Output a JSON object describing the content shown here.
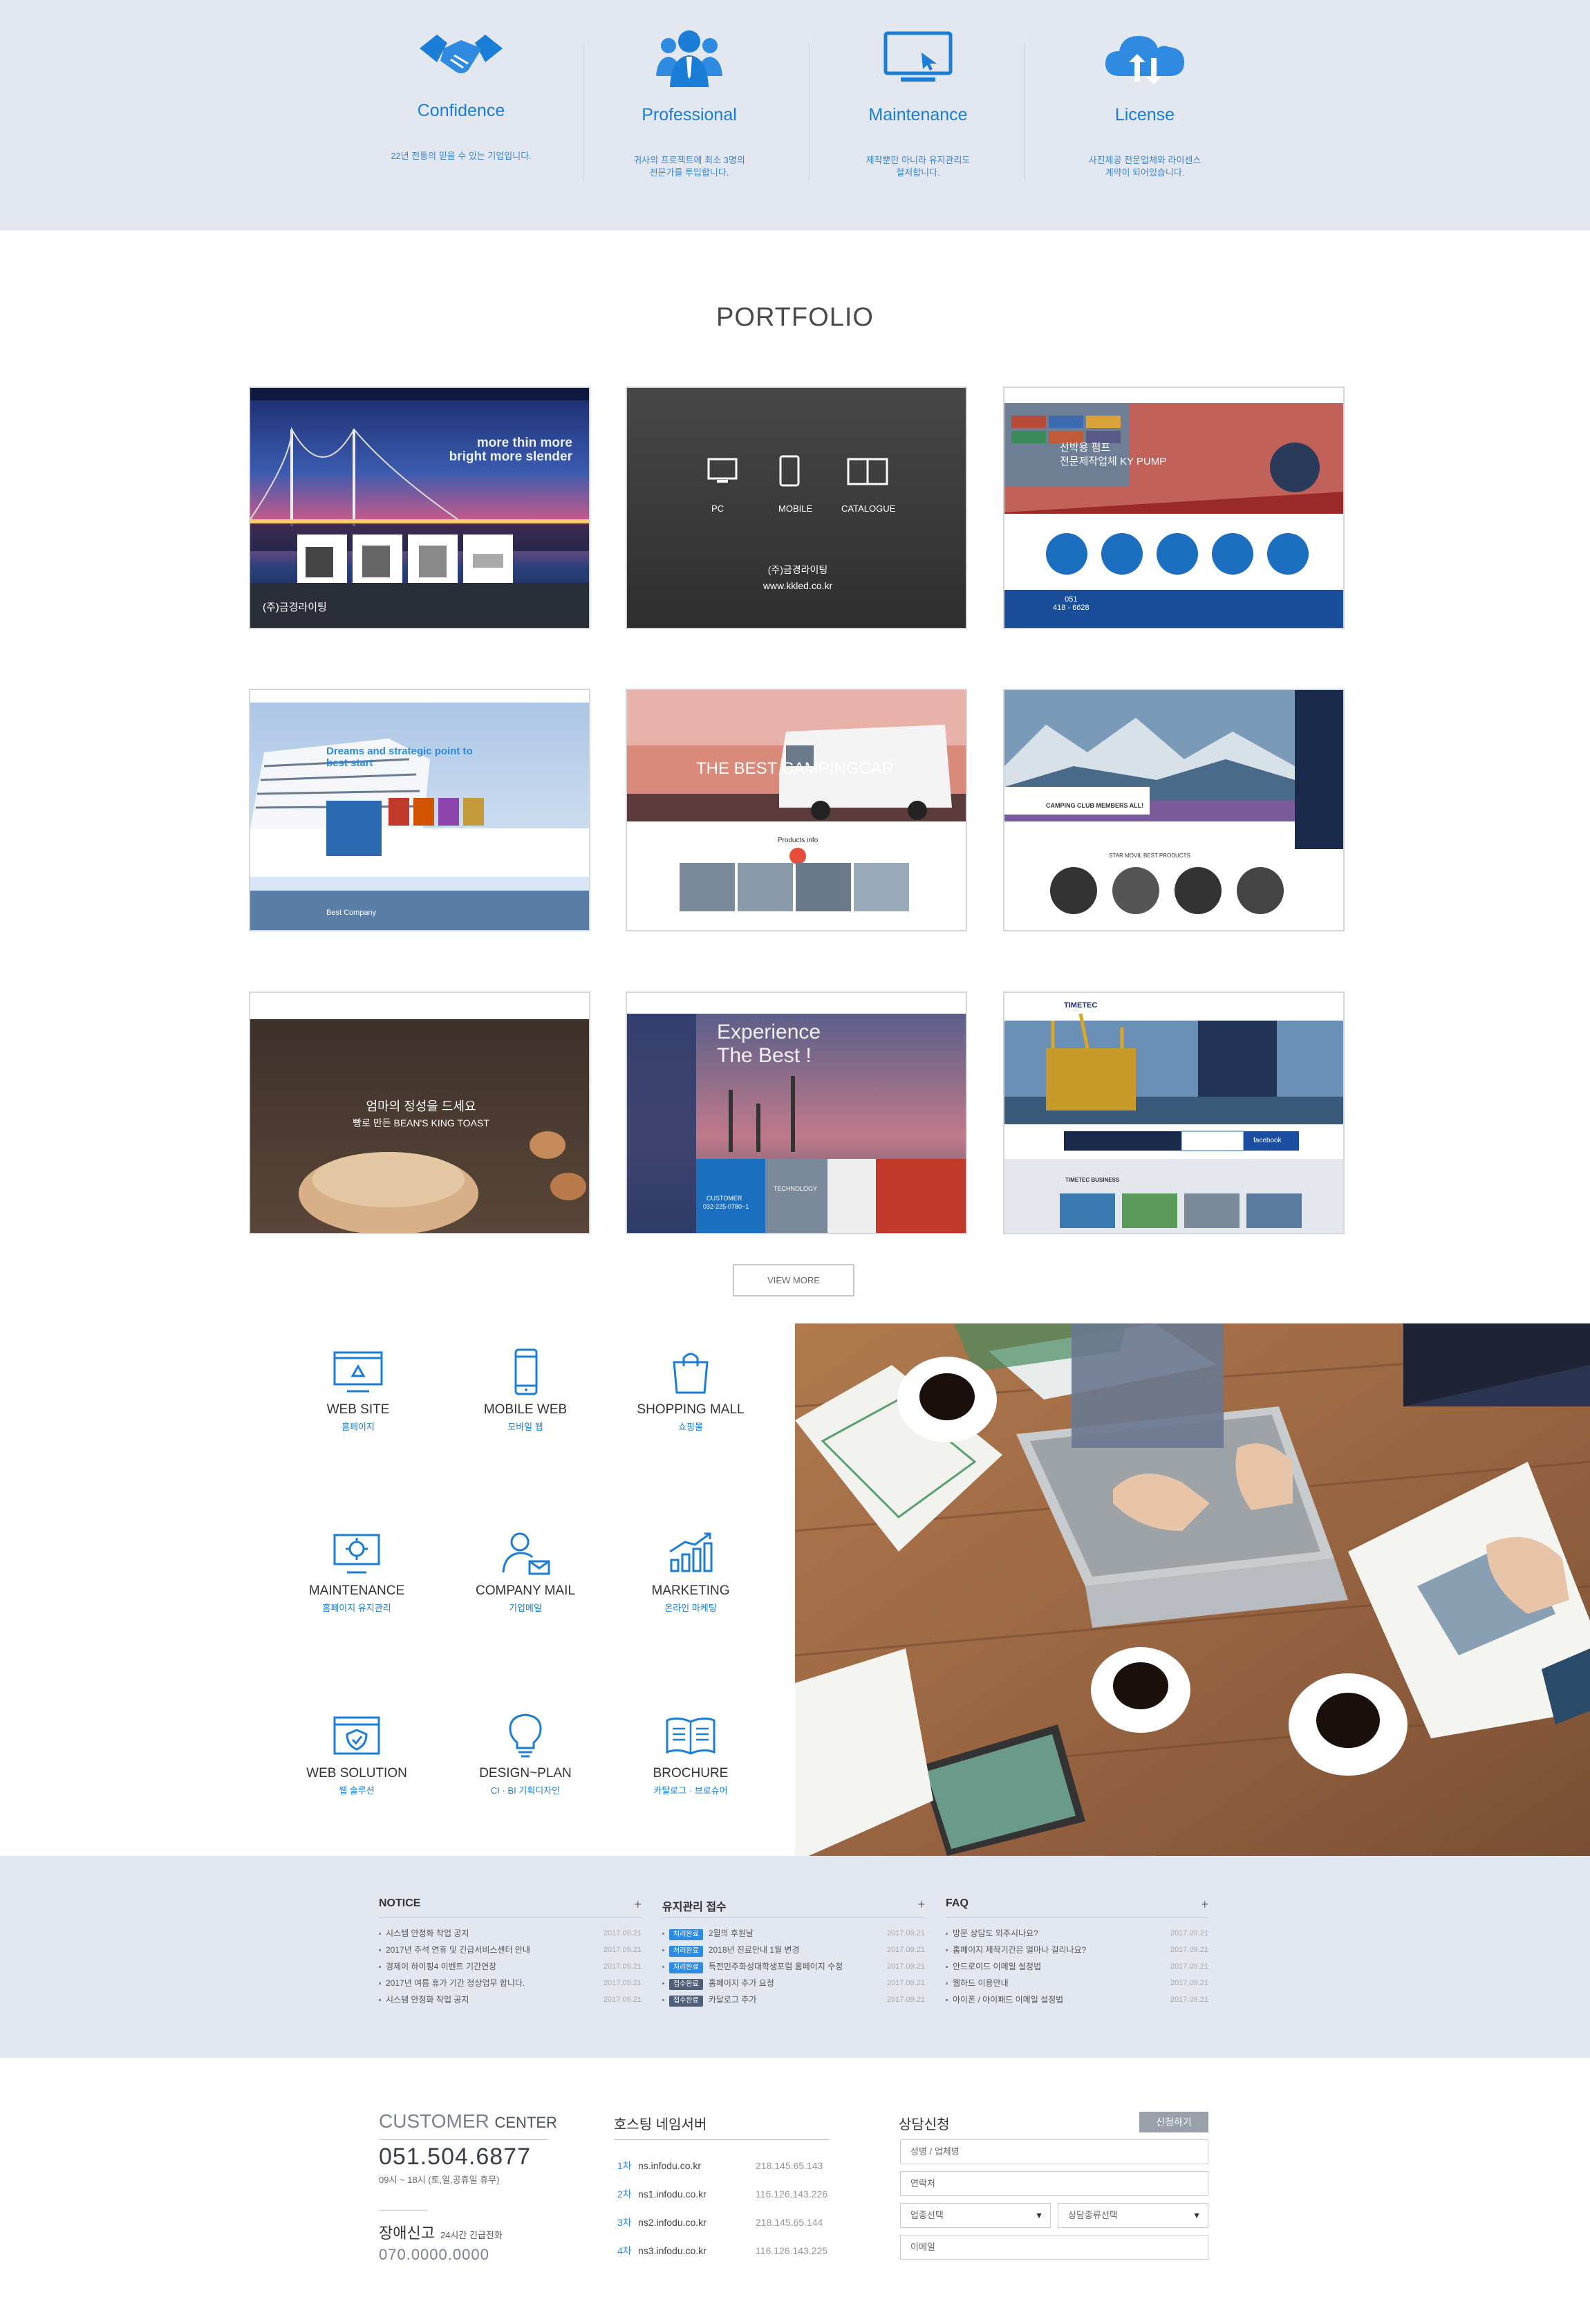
{
  "features": [
    {
      "title": "Confidence",
      "desc": "22년 전통의 믿을 수 있는 기업입니다.",
      "icon": "handshake-icon"
    },
    {
      "title": "Professional",
      "desc": "귀사의 프로젝트에 최소 3명의\n전문가를 투입합니다.",
      "icon": "team-icon"
    },
    {
      "title": "Maintenance",
      "desc": "제작뿐만 아니라 유지관리도\n철저합니다.",
      "icon": "monitor-icon"
    },
    {
      "title": "License",
      "desc": "사진제공 전문업체와 라이센스\n계약이 되어있습니다.",
      "icon": "cloud-upload-icon"
    }
  ],
  "portfolio": {
    "title": "PORTFOLIO",
    "view_more": "VIEW MORE",
    "items": [
      {
        "company": "(주)금경라이팅",
        "headline": "more thin more bright more slender"
      },
      {
        "company": "(주)금경라이팅",
        "url": "www.kkled.co.kr",
        "btn_pc": "PC",
        "btn_mobile": "MOBILE",
        "btn_catalogue": "CATALOGUE"
      },
      {
        "headline1": "선박용 펌프",
        "headline2": "전문제작업체 KY PUMP",
        "phone": "051\n418 - 6628"
      },
      {
        "headline": "Dreams and strategic point to best start",
        "sub": "Best Company"
      },
      {
        "headline": "THE BEST CAMPINGCAR",
        "sub": "Products info"
      },
      {
        "sub": "CAMPING CLUB MEMBERS ALL!",
        "sub2": "STAR MOVIL BEST PRODUCTS"
      },
      {
        "headline1": "엄마의 정성을 드세요",
        "headline2": "빵로 만든 BEAN'S KING TOAST"
      },
      {
        "headline": "Experience The Best !",
        "sub": "CUSTOMER",
        "phone": "032-225-0780~1",
        "tech": "TECHNOLOGY"
      },
      {
        "brand": "TIMETEC",
        "sub": "TIMETEC BUSINESS",
        "fb": "facebook"
      }
    ]
  },
  "services": [
    {
      "title": "WEB SITE",
      "sub": "홈페이지",
      "icon": "website-icon"
    },
    {
      "title": "MOBILE WEB",
      "sub": "모바일 웹",
      "icon": "mobile-icon"
    },
    {
      "title": "SHOPPING MALL",
      "sub": "쇼핑몰",
      "icon": "shopping-bag-icon"
    },
    {
      "title": "MAINTENANCE",
      "sub": "홈페이지 유지관리",
      "icon": "maintenance-icon"
    },
    {
      "title": "COMPANY MAIL",
      "sub": "기업메일",
      "icon": "company-mail-icon"
    },
    {
      "title": "MARKETING",
      "sub": "온라인 마케팅",
      "icon": "chart-icon"
    },
    {
      "title": "WEB SOLUTION",
      "sub": "웹 솔루션",
      "icon": "web-solution-icon"
    },
    {
      "title": "DESIGN~PLAN",
      "sub": "CI · BI 기획디자인",
      "icon": "lightbulb-icon"
    },
    {
      "title": "BROCHURE",
      "sub": "카탈로그 · 브로슈어",
      "icon": "brochure-icon"
    }
  ],
  "boards": [
    {
      "title": "NOTICE",
      "items": [
        {
          "text": "시스템 안정화 작업 공지",
          "date": "2017.09.21"
        },
        {
          "text": "2017년 추석 연휴 및 긴급서비스센터 안내",
          "date": "2017.09.21"
        },
        {
          "text": "경제이 하이핑4 이벤트 기간연장",
          "date": "2017.09.21"
        },
        {
          "text": "2017년 여름 휴가 기간 정상업무 합니다.",
          "date": "2017.09.21"
        },
        {
          "text": "시스템 안정화 작업 공지",
          "date": "2017.09.21"
        }
      ]
    },
    {
      "title": "유지관리 접수",
      "items": [
        {
          "tag": "처리완료",
          "text": "2월의 후원날",
          "date": "2017.09.21"
        },
        {
          "tag": "처리완료",
          "text": "2018년 진료안내 1월 변경",
          "date": "2017.09.21"
        },
        {
          "tag": "처리완료",
          "text": "특전민주화성대학생포럼 홈페이지 수정",
          "date": "2017.09.21"
        },
        {
          "tag": "접수완료",
          "text": "홈페이지 추가 요청",
          "date": "2017.09.21"
        },
        {
          "tag": "접수완료",
          "text": "카달로그 추가",
          "date": "2017.09.21"
        }
      ]
    },
    {
      "title": "FAQ",
      "items": [
        {
          "text": "방문 상담도 외주시나요?",
          "date": "2017.09.21"
        },
        {
          "text": "홈페이지 제작기간은 얼마나 걸리나요?",
          "date": "2017.09.21"
        },
        {
          "text": "안드로이드 이메일 설정법",
          "date": "2017.09.21"
        },
        {
          "text": "웹하드 이용안내",
          "date": "2017.09.21"
        },
        {
          "text": "아이폰 / 아이패드 이메일 설정법",
          "date": "2017.09.21"
        }
      ]
    }
  ],
  "customer_center": {
    "title_a": "CUSTOMER",
    "title_b": "CENTER",
    "phone": "051.504.6877",
    "hours": "09시 ~ 18시 (토,일,공휴일 휴무)",
    "error_title": "장애신고",
    "error_sub": "24시간 긴급전화",
    "error_phone": "070.0000.0000"
  },
  "hosting": {
    "title": "호스팅 네임서버",
    "rows": [
      {
        "no": "1차",
        "domain": "ns.infodu.co.kr",
        "ip": "218.145.65.143"
      },
      {
        "no": "2차",
        "domain": "ns1.infodu.co.kr",
        "ip": "116.126.143.226"
      },
      {
        "no": "3차",
        "domain": "ns2.infodu.co.kr",
        "ip": "218.145.65.144"
      },
      {
        "no": "4차",
        "domain": "ns3.infodu.co.kr",
        "ip": "116.126.143.225"
      }
    ]
  },
  "consult": {
    "title": "상담신청",
    "button": "신청하기",
    "name_placeholder": "성명 / 업체명",
    "phone_placeholder": "연락처",
    "type_select": "업종선택",
    "kind_select": "상담종류선택",
    "email_placeholder": "이메일"
  },
  "colors": {
    "accent": "#1b7ed6",
    "band": "#e2e7f0"
  }
}
